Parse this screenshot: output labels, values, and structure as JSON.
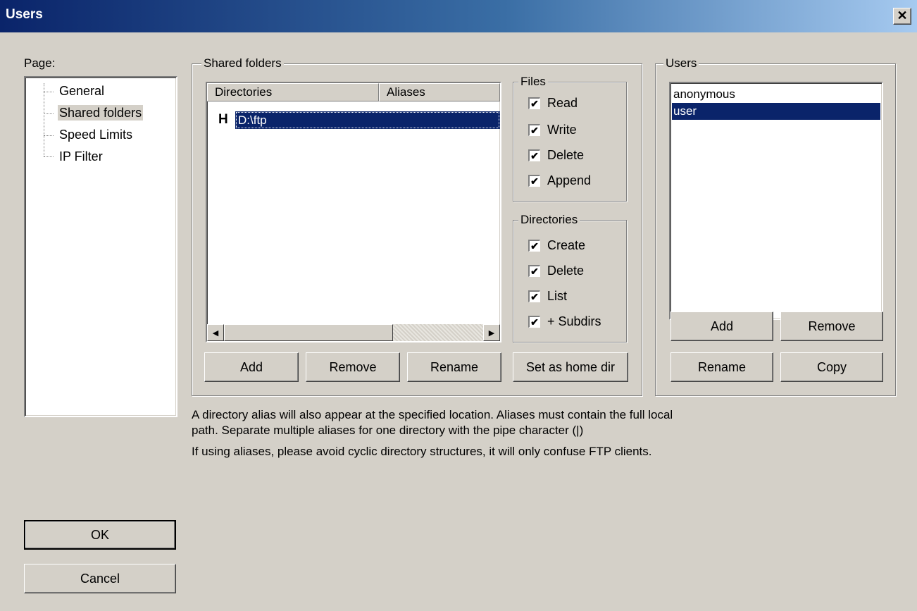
{
  "window": {
    "title": "Users",
    "close_glyph": "✕"
  },
  "page_panel": {
    "label": "Page:",
    "items": [
      "General",
      "Shared folders",
      "Speed Limits",
      "IP Filter"
    ],
    "selected_index": 1
  },
  "shared_folders": {
    "label": "Shared folders",
    "columns": [
      "Directories",
      "Aliases"
    ],
    "rows": [
      {
        "home_marker": "H",
        "directory": "D:\\ftp",
        "alias": ""
      }
    ],
    "buttons": {
      "add": "Add",
      "remove": "Remove",
      "rename": "Rename",
      "home": "Set as home dir"
    }
  },
  "files_group": {
    "label": "Files",
    "options": [
      {
        "label": "Read",
        "checked": true
      },
      {
        "label": "Write",
        "checked": true
      },
      {
        "label": "Delete",
        "checked": true
      },
      {
        "label": "Append",
        "checked": true
      }
    ]
  },
  "directories_group": {
    "label": "Directories",
    "options": [
      {
        "label": "Create",
        "checked": true
      },
      {
        "label": "Delete",
        "checked": true
      },
      {
        "label": "List",
        "checked": true
      },
      {
        "label": "+ Subdirs",
        "checked": true
      }
    ]
  },
  "users_group": {
    "label": "Users",
    "users": [
      "anonymous",
      "user"
    ],
    "selected_index": 1,
    "buttons": {
      "add": "Add",
      "remove": "Remove",
      "rename": "Rename",
      "copy": "Copy"
    }
  },
  "info": {
    "line1": "A directory alias will also appear at the specified location. Aliases must contain the full local",
    "line2": "path. Separate multiple aliases for one directory with the pipe character (|)",
    "line3": "If using aliases, please avoid cyclic directory structures, it will only confuse FTP clients."
  },
  "dialog_buttons": {
    "ok": "OK",
    "cancel": "Cancel"
  },
  "colors": {
    "title_start": "#0a246a",
    "title_end": "#a6caf0",
    "selection": "#0a246a",
    "face": "#d4d0c8"
  }
}
